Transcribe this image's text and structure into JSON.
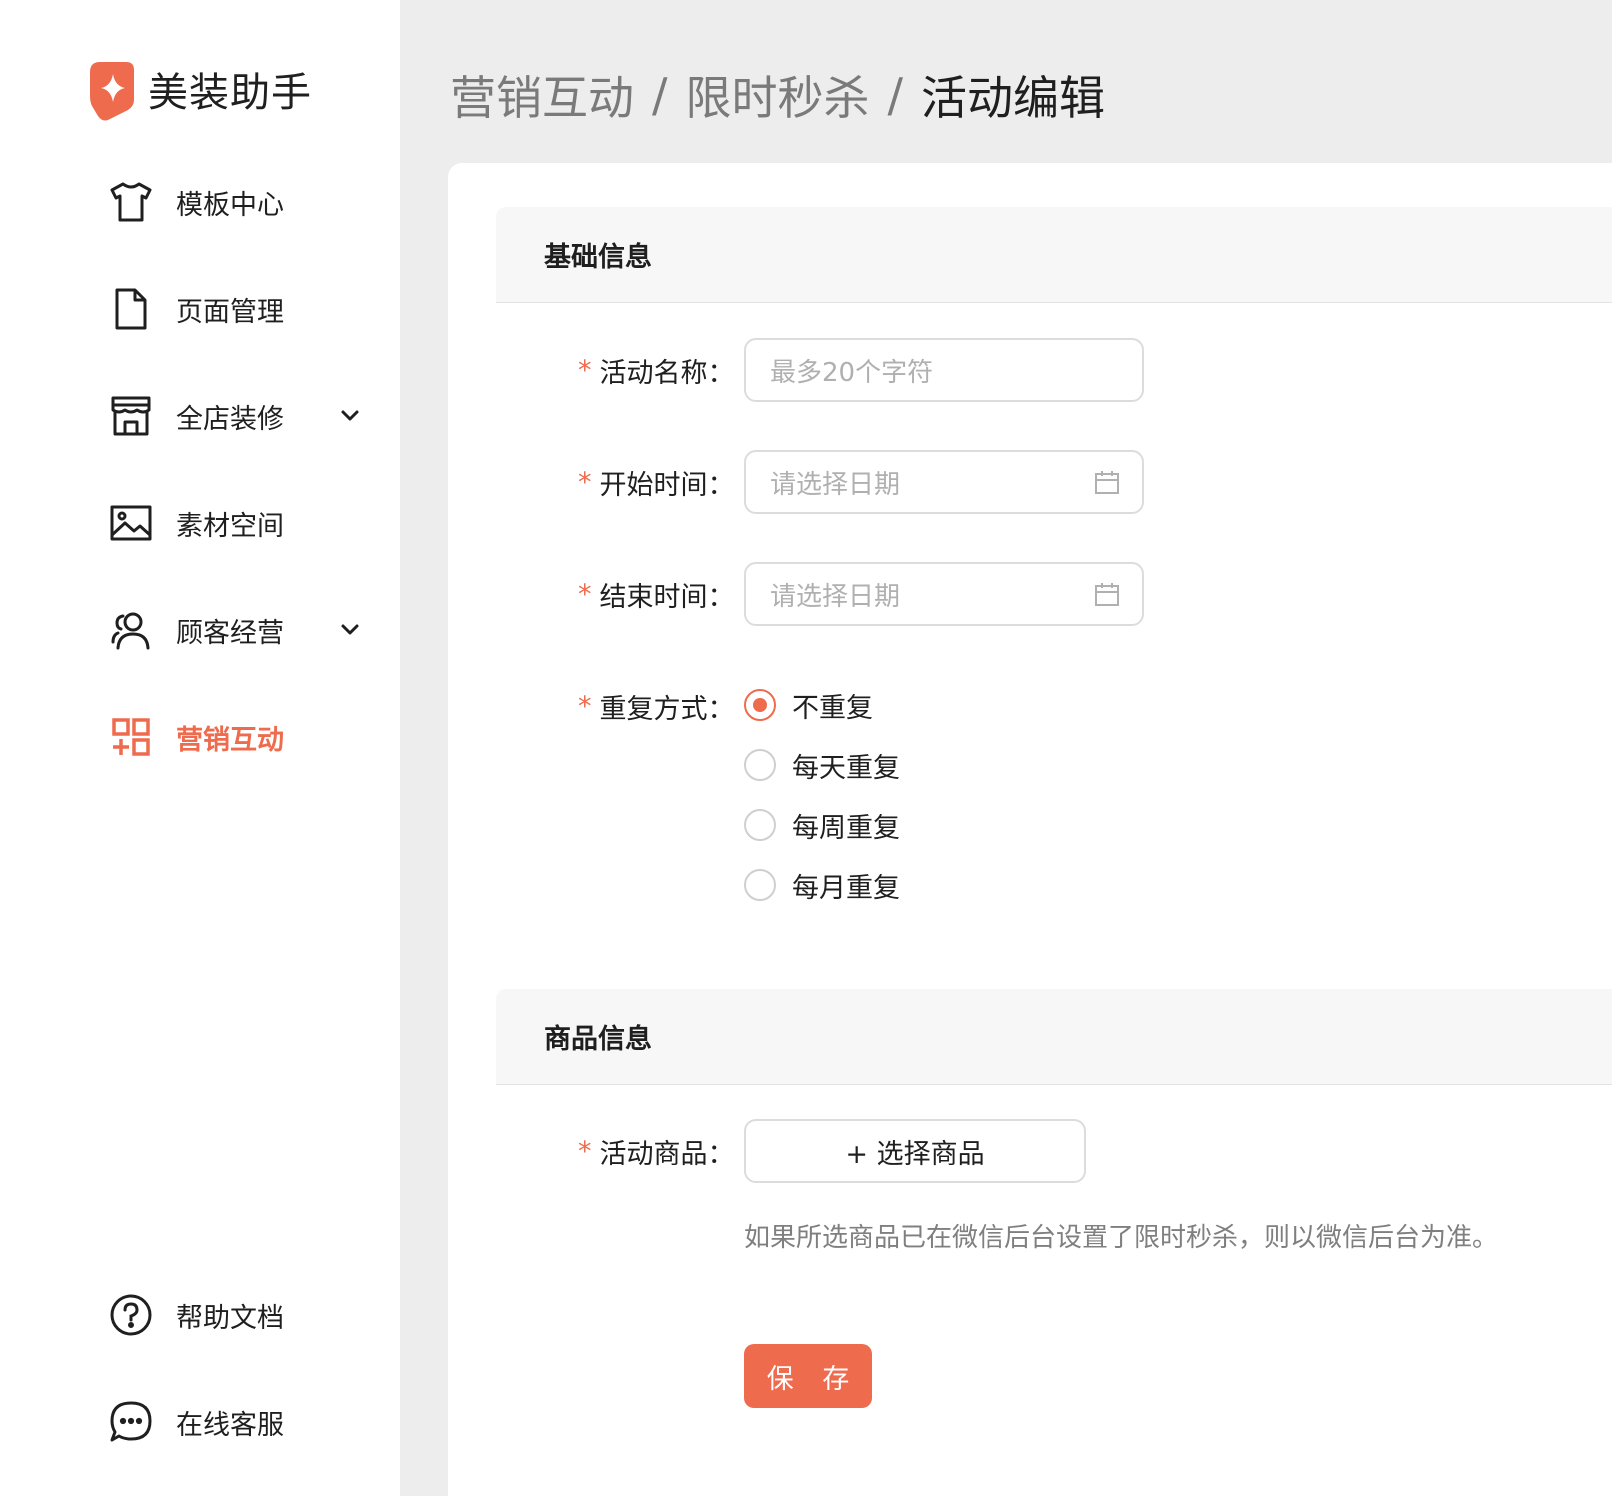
{
  "brand": {
    "name": "美装助手",
    "accent": "#ee6b4d"
  },
  "sidebar": {
    "items": [
      {
        "label": "模板中心",
        "icon": "shirt-icon"
      },
      {
        "label": "页面管理",
        "icon": "file-icon"
      },
      {
        "label": "全店装修",
        "icon": "store-icon",
        "expandable": true
      },
      {
        "label": "素材空间",
        "icon": "image-icon"
      },
      {
        "label": "顾客经营",
        "icon": "users-icon",
        "expandable": true
      },
      {
        "label": "营销互动",
        "icon": "apps-icon",
        "active": true
      }
    ],
    "footer": [
      {
        "label": "帮助文档",
        "icon": "help-icon"
      },
      {
        "label": "在线客服",
        "icon": "chat-icon"
      }
    ]
  },
  "breadcrumb": {
    "part1": "营销互动",
    "sep": "/",
    "part2": "限时秒杀",
    "current": "活动编辑"
  },
  "sections": {
    "basic": {
      "title": "基础信息"
    },
    "product": {
      "title": "商品信息"
    }
  },
  "form": {
    "required_mark": "*",
    "name": {
      "label": "活动名称：",
      "placeholder": "最多20个字符"
    },
    "start": {
      "label": "开始时间：",
      "placeholder": "请选择日期"
    },
    "end": {
      "label": "结束时间：",
      "placeholder": "请选择日期"
    },
    "repeat": {
      "label": "重复方式：",
      "options": [
        "不重复",
        "每天重复",
        "每周重复",
        "每月重复"
      ],
      "selected": "不重复"
    },
    "goods": {
      "label": "活动商品：",
      "button": "+ 选择商品",
      "hint": "如果所选商品已在微信后台设置了限时秒杀，则以微信后台为准。"
    },
    "save": "保 存"
  }
}
